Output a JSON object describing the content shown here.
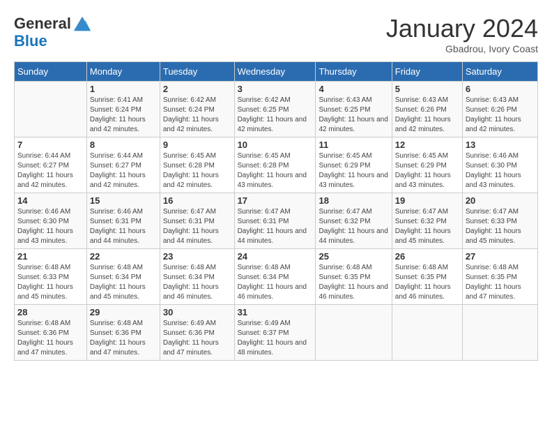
{
  "header": {
    "logo_general": "General",
    "logo_blue": "Blue",
    "month": "January 2024",
    "location": "Gbadrou, Ivory Coast"
  },
  "columns": [
    "Sunday",
    "Monday",
    "Tuesday",
    "Wednesday",
    "Thursday",
    "Friday",
    "Saturday"
  ],
  "weeks": [
    [
      {
        "day": "",
        "info": ""
      },
      {
        "day": "1",
        "info": "Sunrise: 6:41 AM\nSunset: 6:24 PM\nDaylight: 11 hours and 42 minutes."
      },
      {
        "day": "2",
        "info": "Sunrise: 6:42 AM\nSunset: 6:24 PM\nDaylight: 11 hours and 42 minutes."
      },
      {
        "day": "3",
        "info": "Sunrise: 6:42 AM\nSunset: 6:25 PM\nDaylight: 11 hours and 42 minutes."
      },
      {
        "day": "4",
        "info": "Sunrise: 6:43 AM\nSunset: 6:25 PM\nDaylight: 11 hours and 42 minutes."
      },
      {
        "day": "5",
        "info": "Sunrise: 6:43 AM\nSunset: 6:26 PM\nDaylight: 11 hours and 42 minutes."
      },
      {
        "day": "6",
        "info": "Sunrise: 6:43 AM\nSunset: 6:26 PM\nDaylight: 11 hours and 42 minutes."
      }
    ],
    [
      {
        "day": "7",
        "info": "Sunrise: 6:44 AM\nSunset: 6:27 PM\nDaylight: 11 hours and 42 minutes."
      },
      {
        "day": "8",
        "info": "Sunrise: 6:44 AM\nSunset: 6:27 PM\nDaylight: 11 hours and 42 minutes."
      },
      {
        "day": "9",
        "info": "Sunrise: 6:45 AM\nSunset: 6:28 PM\nDaylight: 11 hours and 42 minutes."
      },
      {
        "day": "10",
        "info": "Sunrise: 6:45 AM\nSunset: 6:28 PM\nDaylight: 11 hours and 43 minutes."
      },
      {
        "day": "11",
        "info": "Sunrise: 6:45 AM\nSunset: 6:29 PM\nDaylight: 11 hours and 43 minutes."
      },
      {
        "day": "12",
        "info": "Sunrise: 6:45 AM\nSunset: 6:29 PM\nDaylight: 11 hours and 43 minutes."
      },
      {
        "day": "13",
        "info": "Sunrise: 6:46 AM\nSunset: 6:30 PM\nDaylight: 11 hours and 43 minutes."
      }
    ],
    [
      {
        "day": "14",
        "info": "Sunrise: 6:46 AM\nSunset: 6:30 PM\nDaylight: 11 hours and 43 minutes."
      },
      {
        "day": "15",
        "info": "Sunrise: 6:46 AM\nSunset: 6:31 PM\nDaylight: 11 hours and 44 minutes."
      },
      {
        "day": "16",
        "info": "Sunrise: 6:47 AM\nSunset: 6:31 PM\nDaylight: 11 hours and 44 minutes."
      },
      {
        "day": "17",
        "info": "Sunrise: 6:47 AM\nSunset: 6:31 PM\nDaylight: 11 hours and 44 minutes."
      },
      {
        "day": "18",
        "info": "Sunrise: 6:47 AM\nSunset: 6:32 PM\nDaylight: 11 hours and 44 minutes."
      },
      {
        "day": "19",
        "info": "Sunrise: 6:47 AM\nSunset: 6:32 PM\nDaylight: 11 hours and 45 minutes."
      },
      {
        "day": "20",
        "info": "Sunrise: 6:47 AM\nSunset: 6:33 PM\nDaylight: 11 hours and 45 minutes."
      }
    ],
    [
      {
        "day": "21",
        "info": "Sunrise: 6:48 AM\nSunset: 6:33 PM\nDaylight: 11 hours and 45 minutes."
      },
      {
        "day": "22",
        "info": "Sunrise: 6:48 AM\nSunset: 6:34 PM\nDaylight: 11 hours and 45 minutes."
      },
      {
        "day": "23",
        "info": "Sunrise: 6:48 AM\nSunset: 6:34 PM\nDaylight: 11 hours and 46 minutes."
      },
      {
        "day": "24",
        "info": "Sunrise: 6:48 AM\nSunset: 6:34 PM\nDaylight: 11 hours and 46 minutes."
      },
      {
        "day": "25",
        "info": "Sunrise: 6:48 AM\nSunset: 6:35 PM\nDaylight: 11 hours and 46 minutes."
      },
      {
        "day": "26",
        "info": "Sunrise: 6:48 AM\nSunset: 6:35 PM\nDaylight: 11 hours and 46 minutes."
      },
      {
        "day": "27",
        "info": "Sunrise: 6:48 AM\nSunset: 6:35 PM\nDaylight: 11 hours and 47 minutes."
      }
    ],
    [
      {
        "day": "28",
        "info": "Sunrise: 6:48 AM\nSunset: 6:36 PM\nDaylight: 11 hours and 47 minutes."
      },
      {
        "day": "29",
        "info": "Sunrise: 6:48 AM\nSunset: 6:36 PM\nDaylight: 11 hours and 47 minutes."
      },
      {
        "day": "30",
        "info": "Sunrise: 6:49 AM\nSunset: 6:36 PM\nDaylight: 11 hours and 47 minutes."
      },
      {
        "day": "31",
        "info": "Sunrise: 6:49 AM\nSunset: 6:37 PM\nDaylight: 11 hours and 48 minutes."
      },
      {
        "day": "",
        "info": ""
      },
      {
        "day": "",
        "info": ""
      },
      {
        "day": "",
        "info": ""
      }
    ]
  ]
}
